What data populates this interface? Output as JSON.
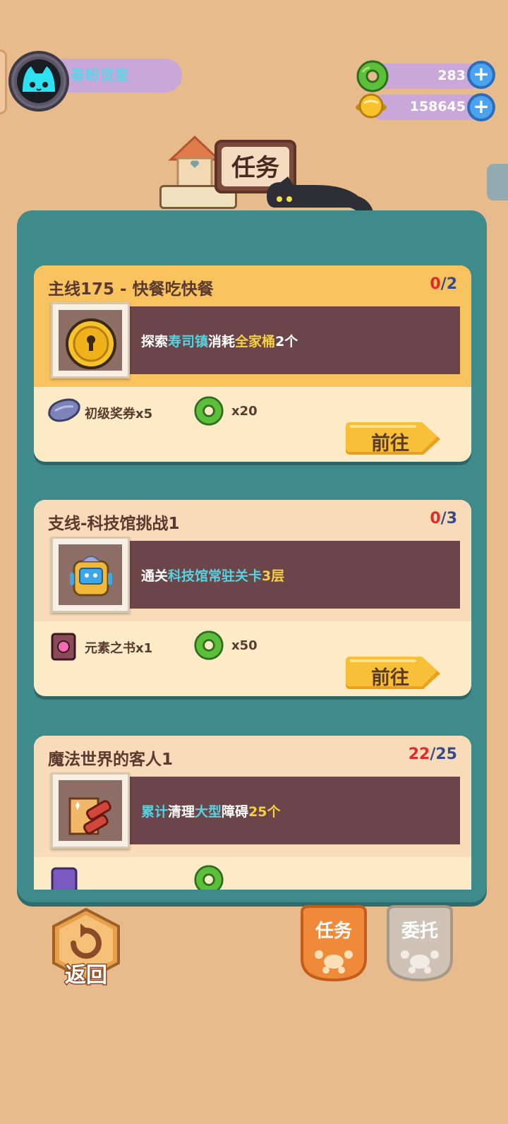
{
  "profile": {
    "name": "春盼觉星"
  },
  "currencies": [
    {
      "icon": "green-donut-icon",
      "value": "283"
    },
    {
      "icon": "gold-coin-icon",
      "value": "158645"
    }
  ],
  "header": {
    "title": "任务"
  },
  "tasks": [
    {
      "title": "主线175 - 快餐吃快餐",
      "progress_current": "0",
      "progress_sep": "/",
      "progress_total": "2",
      "thumb_icon": "golden-coin-lock-icon",
      "text_parts": [
        "探索",
        "寿司镇",
        "消耗",
        "全家桶",
        "2个"
      ],
      "rewards": [
        {
          "icon": "ticket-icon",
          "label": "初级奖券x5"
        },
        {
          "icon": "green-donut-icon",
          "label": "x20"
        }
      ],
      "button": "前往"
    },
    {
      "title": "支线-科技馆挑战1",
      "progress_current": "0",
      "progress_sep": "/",
      "progress_total": "3",
      "thumb_icon": "robot-icon",
      "text_parts": [
        "通关",
        "科技馆常驻关卡",
        "3层"
      ],
      "rewards": [
        {
          "icon": "element-book-icon",
          "label": "元素之书x1"
        },
        {
          "icon": "green-donut-icon",
          "label": "x50"
        }
      ],
      "button": "前往"
    },
    {
      "title": "魔法世界的客人1",
      "progress_current": "22",
      "progress_sep": "/",
      "progress_total": "25",
      "thumb_icon": "cleaning-tool-icon",
      "text_parts": [
        "累计",
        "清理",
        "大型",
        "障碍",
        "25个"
      ],
      "rewards": [
        {
          "icon": "purple-card-icon",
          "label": ""
        },
        {
          "icon": "green-donut-icon",
          "label": ""
        }
      ]
    }
  ],
  "nav": {
    "back": "返回",
    "tasks": "任务",
    "commission": "委托"
  },
  "colors": {
    "background": "#e8bb8c",
    "panel": "#3f8a8a",
    "card": "#fdeac6",
    "card_header_active": "#f8c35e",
    "task_box": "#6b4549",
    "progress_current": "#e22a2a",
    "highlight_cyan": "#55d3e0",
    "highlight_yellow": "#f5d040",
    "button": "#f7c038"
  }
}
